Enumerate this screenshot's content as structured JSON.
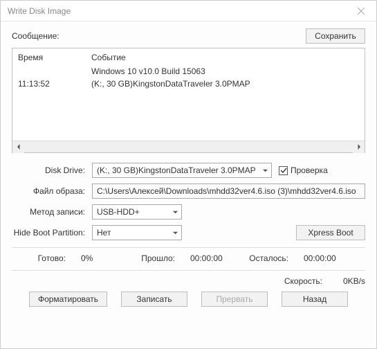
{
  "window": {
    "title": "Write Disk Image"
  },
  "message_label": "Сообщение:",
  "save_btn": "Сохранить",
  "log": {
    "header_time": "Время",
    "header_event": "Событие",
    "rows": [
      {
        "time": "",
        "event": "Windows 10 v10.0 Build 15063"
      },
      {
        "time": "11:13:52",
        "event": "(K:, 30 GB)KingstonDataTraveler 3.0PMAP"
      }
    ]
  },
  "form": {
    "disk_drive_label": "Disk Drive:",
    "disk_drive_value": "(K:, 30 GB)KingstonDataTraveler 3.0PMAP",
    "verify_label": "Проверка",
    "verify_checked": true,
    "image_label": "Файл образа:",
    "image_value": "C:\\Users\\Алексей\\Downloads\\mhdd32ver4.6.iso (3)\\mhdd32ver4.6.iso",
    "write_method_label": "Метод записи:",
    "write_method_value": "USB-HDD+",
    "hide_boot_label": "Hide Boot Partition:",
    "hide_boot_value": "Нет",
    "xpress_btn": "Xpress Boot"
  },
  "status": {
    "ready_label": "Готово:",
    "ready_value": "0%",
    "elapsed_label": "Прошло:",
    "elapsed_value": "00:00:00",
    "remaining_label": "Осталось:",
    "remaining_value": "00:00:00",
    "speed_label": "Скорость:",
    "speed_value": "0KB/s"
  },
  "actions": {
    "format": "Форматировать",
    "write": "Записать",
    "abort": "Прервать",
    "back": "Назад"
  }
}
